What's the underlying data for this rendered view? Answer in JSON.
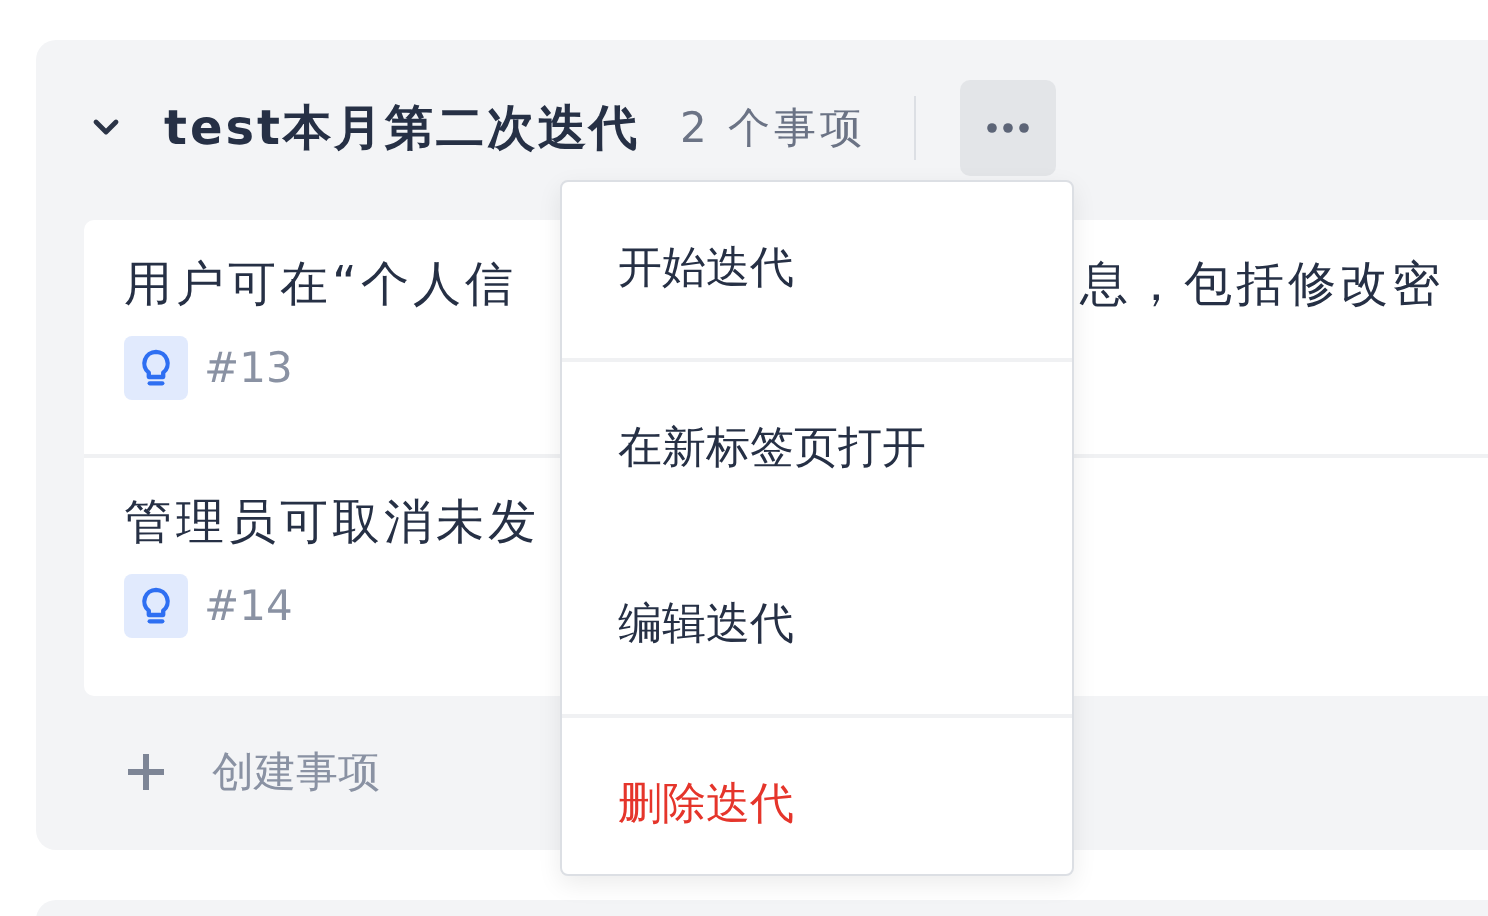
{
  "sprint": {
    "title": "test本月第二次迭代",
    "count": "2 个事项",
    "expanded": true
  },
  "issues": [
    {
      "title_left": "用户可在“个人信",
      "title_right": "息，包括修改密",
      "number": "#13"
    },
    {
      "title_left": "管理员可取消未发",
      "number": "#14"
    }
  ],
  "create": "创建事项",
  "menu": [
    {
      "label": "开始迭代",
      "kind": "normal",
      "divider_after": true
    },
    {
      "label": "在新标签页打开",
      "kind": "normal",
      "divider_after": false
    },
    {
      "label": "编辑迭代",
      "kind": "normal",
      "divider_after": true
    },
    {
      "label": "删除迭代",
      "kind": "danger",
      "divider_after": false
    }
  ]
}
